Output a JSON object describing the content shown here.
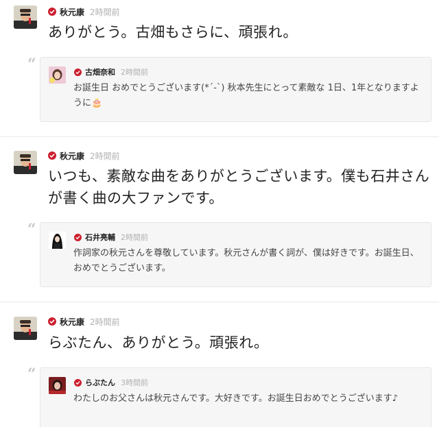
{
  "posts": [
    {
      "author": "秋元康",
      "time": "2時間前",
      "text": "ありがとう。古畑もさらに、頑張れ。",
      "quote": {
        "author": "古畑奈和",
        "time": "2時間前",
        "text": "お誕生日 おめでとうございます(*´-`) 秋本先生にとって素敵な 1日、1年となりますように🎂"
      }
    },
    {
      "author": "秋元康",
      "time": "2時間前",
      "text": "いつも、素敵な曲をありがとうございます。僕も石井さんが書く曲の大ファンです。",
      "quote": {
        "author": "石井亮輔",
        "time": "2時間前",
        "text": "作詞家の秋元さんを尊敬しています。秋元さんが書く詞が、僕は好きです。お誕生日、おめでとうございます。"
      }
    },
    {
      "author": "秋元康",
      "time": "2時間前",
      "text": "らぶたん、ありがとう。頑張れ。",
      "quote": {
        "author": "らぶたん",
        "time": "3時間前",
        "text": "わたしのお父さんは秋元さんです。大好きです。お誕生日おめでとうございます♪"
      }
    }
  ],
  "icons": {
    "verified": "verified-check-icon",
    "quote": "quote-mark-icon"
  },
  "colors": {
    "verified_badge": "#cc1f2f",
    "quote_box_bg": "#f6f6f6",
    "timestamp": "#b0b0b0"
  }
}
